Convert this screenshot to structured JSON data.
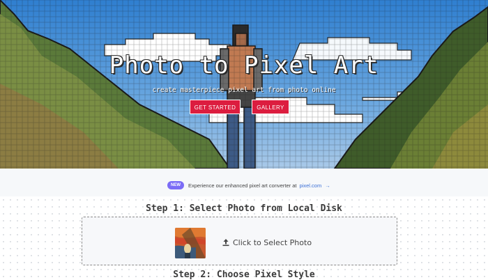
{
  "hero": {
    "title": "Photo to Pixel Art",
    "subtitle": "create masterpiece pixel art from photo online",
    "buttons": {
      "get_started": "GET STARTED",
      "gallery": "GALLERY"
    }
  },
  "notice": {
    "badge": "NEW",
    "text": "Experience our enhanced pixel art converter at",
    "link": "pixel.com",
    "arrow": "→"
  },
  "steps": {
    "step1_title": "Step 1: Select Photo from Local Disk",
    "select_label": "Click to Select Photo",
    "step2_title": "Step 2: Choose Pixel Style"
  },
  "icons": {
    "upload": "upload-icon"
  },
  "colors": {
    "button": "#dc1d3f",
    "badge": "#7b6cf6",
    "link": "#3b6fd6"
  }
}
